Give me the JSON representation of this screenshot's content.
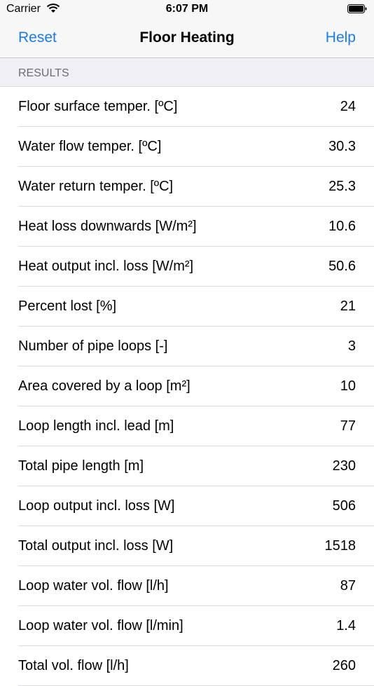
{
  "status_bar": {
    "carrier": "Carrier",
    "time": "6:07 PM"
  },
  "navbar": {
    "left": "Reset",
    "title": "Floor Heating",
    "right": "Help"
  },
  "section": {
    "title": "RESULTS"
  },
  "rows": [
    {
      "label": "Floor surface temper. [ºC]",
      "value": "24"
    },
    {
      "label": "Water flow temper. [ºC]",
      "value": "30.3"
    },
    {
      "label": "Water return temper. [ºC]",
      "value": "25.3"
    },
    {
      "label": "Heat loss downwards [W/m²]",
      "value": "10.6"
    },
    {
      "label": "Heat output incl. loss [W/m²]",
      "value": "50.6"
    },
    {
      "label": "Percent lost [%]",
      "value": "21"
    },
    {
      "label": "Number of pipe loops [-]",
      "value": "3"
    },
    {
      "label": "Area covered by a loop [m²]",
      "value": "10"
    },
    {
      "label": "Loop length incl. lead [m]",
      "value": "77"
    },
    {
      "label": "Total pipe length [m]",
      "value": "230"
    },
    {
      "label": "Loop output incl. loss [W]",
      "value": "506"
    },
    {
      "label": "Total output incl. loss [W]",
      "value": "1518"
    },
    {
      "label": "Loop water vol. flow [l/h]",
      "value": "87"
    },
    {
      "label": "Loop water vol. flow [l/min]",
      "value": "1.4"
    },
    {
      "label": "Total vol. flow [l/h]",
      "value": "260"
    }
  ]
}
